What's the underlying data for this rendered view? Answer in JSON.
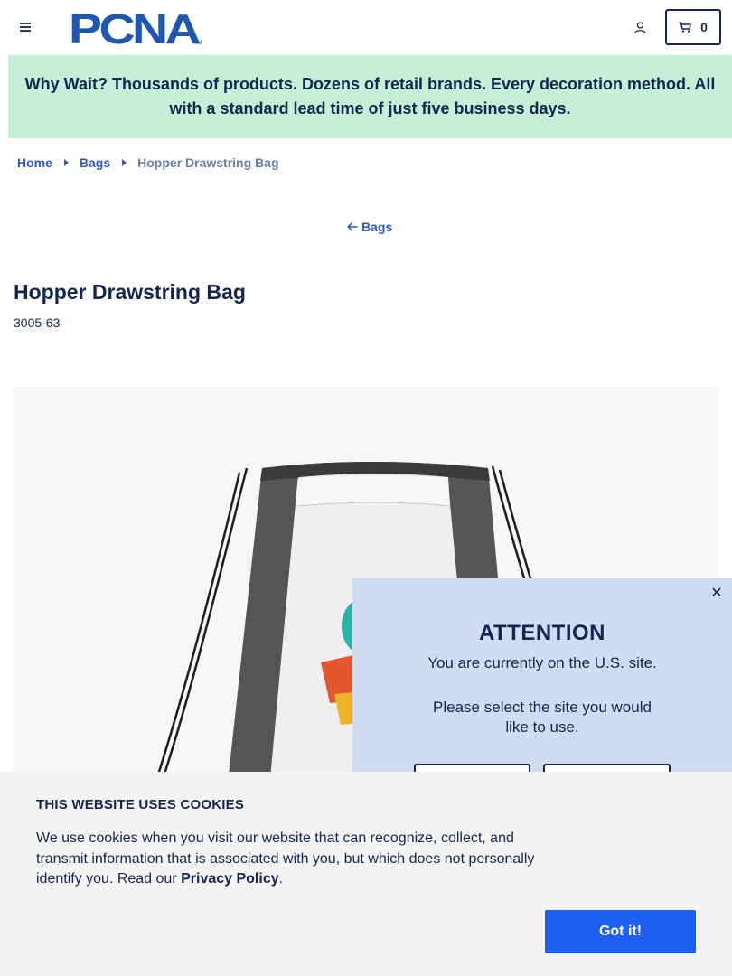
{
  "header": {
    "logo_text": "PCNA",
    "logo_mark": "TM",
    "cart_count": "0",
    "menu_icon": "hamburger-icon",
    "account_icon": "user-icon",
    "cart_icon": "cart-icon"
  },
  "promo": {
    "text": "Why Wait? Thousands of products. Dozens of retail brands. Every decoration method. All with a standard lead time of just five business days."
  },
  "breadcrumb": {
    "items": [
      {
        "label": "Home"
      },
      {
        "label": "Bags"
      }
    ],
    "current": "Hopper Drawstring Bag"
  },
  "back_link": {
    "label": "Bags"
  },
  "product": {
    "title": "Hopper Drawstring Bag",
    "sku": "3005-63"
  },
  "attention": {
    "heading": "ATTENTION",
    "line1": "You are currently on the U.S. site.",
    "line2": "Please select the site you would like to use."
  },
  "cookie": {
    "title": "THIS WEBSITE USES COOKIES",
    "text": "We use cookies when you visit our website that can recognize, collect, and transmit information that is associated with you, but which does not personally identify you. Read our ",
    "link": "Privacy Policy",
    "suffix": ".",
    "button": "Got it!"
  },
  "colors": {
    "navy": "#12264f",
    "link_blue": "#2e5bbd",
    "promo_bg": "#c5efd6",
    "popup_bg": "#cfdcf2",
    "cookie_bg": "#f4f4f4",
    "button_blue": "#1f5ef2",
    "logo_blue": "#1e56b0"
  }
}
